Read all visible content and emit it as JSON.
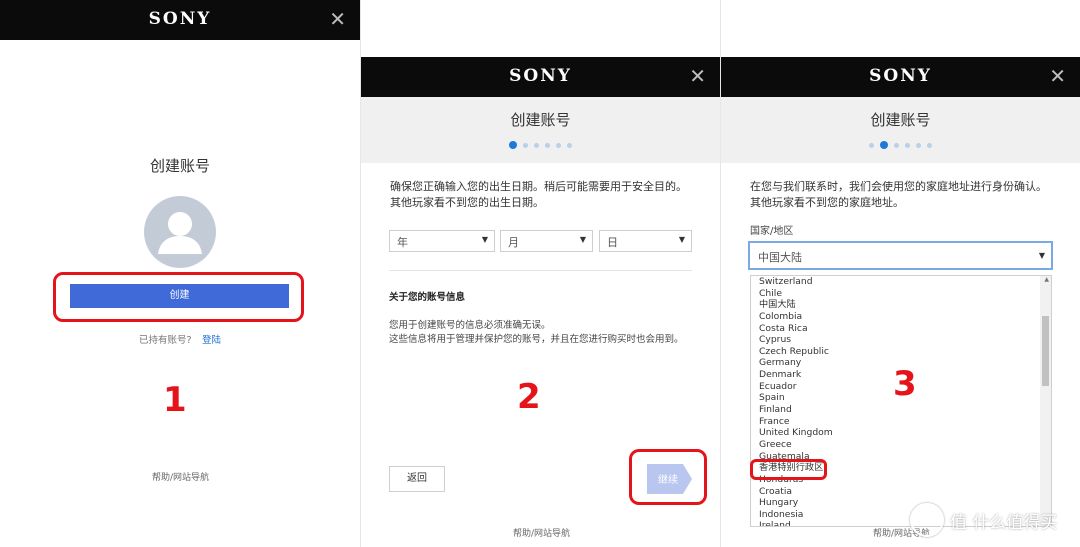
{
  "brand": "SONY",
  "close_glyph": "✕",
  "panel1": {
    "title": "创建账号",
    "create_button": "创建",
    "have_account": "已持有账号?",
    "login_link": "登陆",
    "footer": "帮助/网站导航",
    "step_number": "1"
  },
  "panel2": {
    "title": "创建账号",
    "dots_total": 6,
    "dots_active": 1,
    "intro": "确保您正确输入您的出生日期。稍后可能需要用于安全目的。其他玩家看不到您的出生日期。",
    "year": "年",
    "month": "月",
    "day": "日",
    "section_heading": "关于您的账号信息",
    "info_line1": "您用于创建账号的信息必须准确无误。",
    "info_line2": "这些信息将用于管理并保护您的账号，并且在您进行购买时也会用到。",
    "back_button": "返回",
    "next_button": "继续",
    "footer": "帮助/网站导航",
    "step_number": "2"
  },
  "panel3": {
    "title": "创建账号",
    "dots_total": 6,
    "dots_active": 2,
    "intro": "在您与我们联系时，我们会使用您的家庭地址进行身份确认。其他玩家看不到您的家庭地址。",
    "country_label": "国家/地区",
    "country_value": "中国大陆",
    "options": [
      "Switzerland",
      "Chile",
      "中国大陆",
      "Colombia",
      "Costa Rica",
      "Cyprus",
      "Czech Republic",
      "Germany",
      "Denmark",
      "Ecuador",
      "Spain",
      "Finland",
      "France",
      "United Kingdom",
      "Greece",
      "Guatemala",
      "香港特别行政区",
      "Honduras",
      "Croatia",
      "Hungary",
      "Indonesia",
      "Ireland"
    ],
    "highlighted_option": "香港特别行政区",
    "footer": "帮助/网站导航",
    "step_number": "3"
  },
  "watermark": "值 什么值得买"
}
